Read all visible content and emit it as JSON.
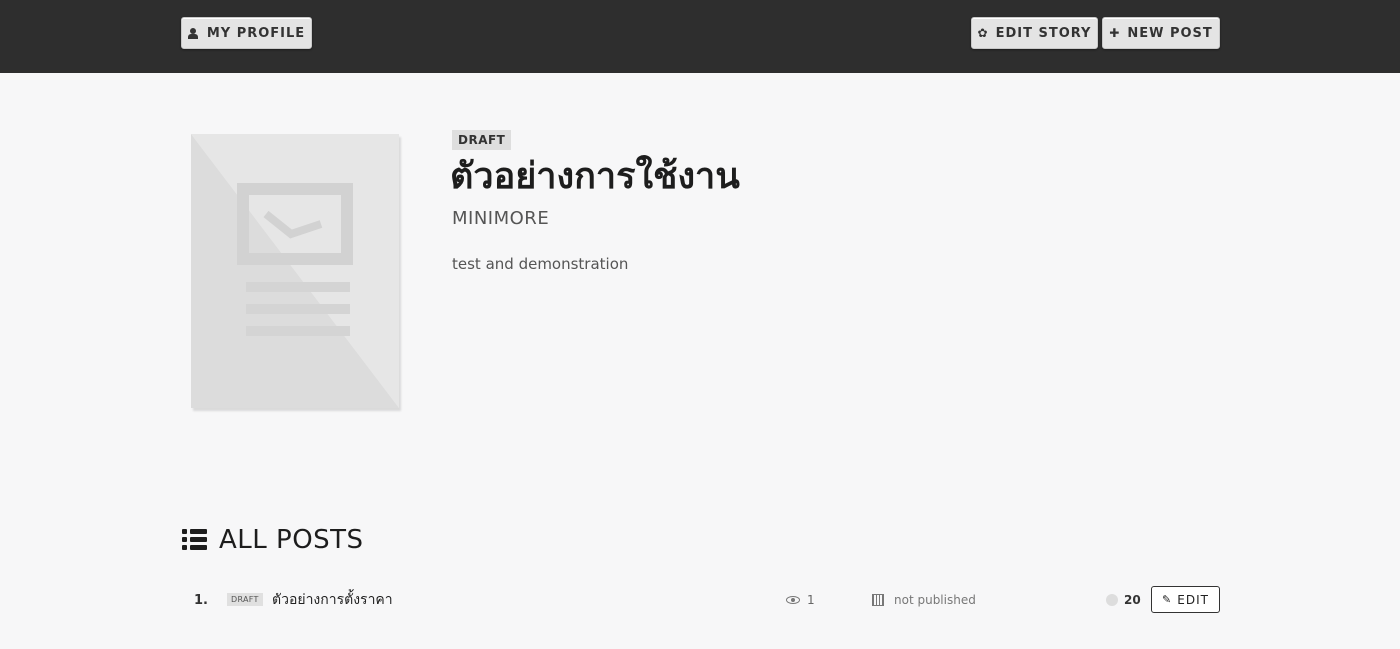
{
  "header": {
    "my_profile_label": "MY PROFILE",
    "edit_story_label": "EDIT STORY",
    "new_post_label": "NEW POST"
  },
  "story": {
    "status_badge": "DRAFT",
    "title": "ตัวอย่างการใช้งาน",
    "author": "MINIMORE",
    "description": "test and demonstration"
  },
  "posts_section": {
    "title": "ALL POSTS",
    "posts": [
      {
        "number": "1.",
        "badge": "DRAFT",
        "title": "ตัวอย่างการตั้งราคา",
        "views": "1",
        "published": "not published",
        "count": "20",
        "edit_label": "EDIT"
      }
    ]
  },
  "icons": {
    "profile": "user-icon",
    "edit_story": "gear-icon",
    "new_post": "plus-icon",
    "section": "list-icon",
    "views": "eye-icon",
    "date": "calendar-icon",
    "edit": "pencil-icon"
  },
  "colors": {
    "topbar": "#2e2e2e",
    "background": "#f7f7f8",
    "button": "#e4e4e4"
  }
}
